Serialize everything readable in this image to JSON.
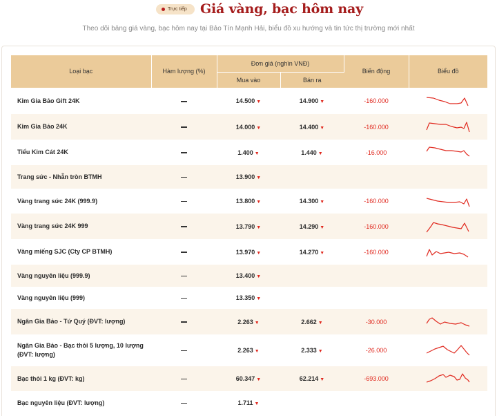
{
  "header": {
    "badge": "Trực tiếp",
    "title": "Giá vàng, bạc hôm nay",
    "subtitle": "Theo dõi bảng giá vàng, bạc hôm nay tại Bảo Tín Mạnh Hải, biểu đồ xu hướng và tin tức thị trường mới nhất"
  },
  "table": {
    "columns": {
      "type": "Loại bạc",
      "purity": "Hàm lượng (%)",
      "unit_price": "Đơn giá (nghìn VNĐ)",
      "buy": "Mua vào",
      "sell": "Bán ra",
      "change": "Biến động",
      "chart": "Biểu đồ"
    },
    "rows": [
      {
        "name": "Kim Gia Bảo Gift 24K",
        "buy": "14.500",
        "sell": "14.900",
        "change": "-160.000",
        "has_chart": true
      },
      {
        "name": "Kim Gia Bảo 24K",
        "buy": "14.000",
        "sell": "14.400",
        "change": "-160.000",
        "has_chart": true
      },
      {
        "name": "Tiểu Kim Cát 24K",
        "buy": "1.400",
        "sell": "1.440",
        "change": "-16.000",
        "has_chart": true
      },
      {
        "name": "Trang sức - Nhẫn tròn BTMH",
        "buy": "13.900",
        "sell": "",
        "change": "",
        "has_chart": false
      },
      {
        "name": "Vàng trang sức 24K (999.9)",
        "buy": "13.800",
        "sell": "14.300",
        "change": "-160.000",
        "has_chart": true
      },
      {
        "name": "Vàng trang sức 24K 999",
        "buy": "13.790",
        "sell": "14.290",
        "change": "-160.000",
        "has_chart": true
      },
      {
        "name": "Vàng miếng SJC (Cty CP BTMH)",
        "buy": "13.970",
        "sell": "14.270",
        "change": "-160.000",
        "has_chart": true
      },
      {
        "name": "Vàng nguyên liệu (999.9)",
        "buy": "13.400",
        "sell": "",
        "change": "",
        "has_chart": false
      },
      {
        "name": "Vàng nguyên liệu (999)",
        "buy": "13.350",
        "sell": "",
        "change": "",
        "has_chart": false
      },
      {
        "name": "Ngân Gia Bảo - Tứ Quý (ĐVT: lượng)",
        "buy": "2.263",
        "sell": "2.662",
        "change": "-30.000",
        "has_chart": true
      },
      {
        "name": "Ngân Gia Bảo - Bạc thỏi 5 lượng, 10 lượng (ĐVT: lượng)",
        "buy": "2.263",
        "sell": "2.333",
        "change": "-26.000",
        "has_chart": true
      },
      {
        "name": "Bạc thỏi 1 kg (ĐVT: kg)",
        "buy": "60.347",
        "sell": "62.214",
        "change": "-693.000",
        "has_chart": true
      },
      {
        "name": "Bạc nguyên liệu (ĐVT: lượng)",
        "buy": "1.711",
        "sell": "",
        "change": "",
        "has_chart": false
      }
    ]
  },
  "colors": {
    "title": "#a51c1c",
    "header_bg": "#ebcb9a",
    "row_alt_bg": "#fbf4ea",
    "down": "#e0291f"
  },
  "icons": {
    "badge_dot": "live-dot-icon",
    "down_arrow": "▼"
  }
}
